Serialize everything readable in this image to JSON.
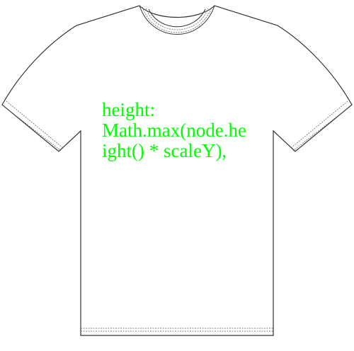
{
  "shirt": {
    "fill_color": "#ffffff",
    "outline_color": "#333333",
    "print": {
      "color": "#00ff00",
      "lines": [
        "height:",
        "Math.max(node.he",
        "ight() * scaleY),"
      ]
    }
  }
}
